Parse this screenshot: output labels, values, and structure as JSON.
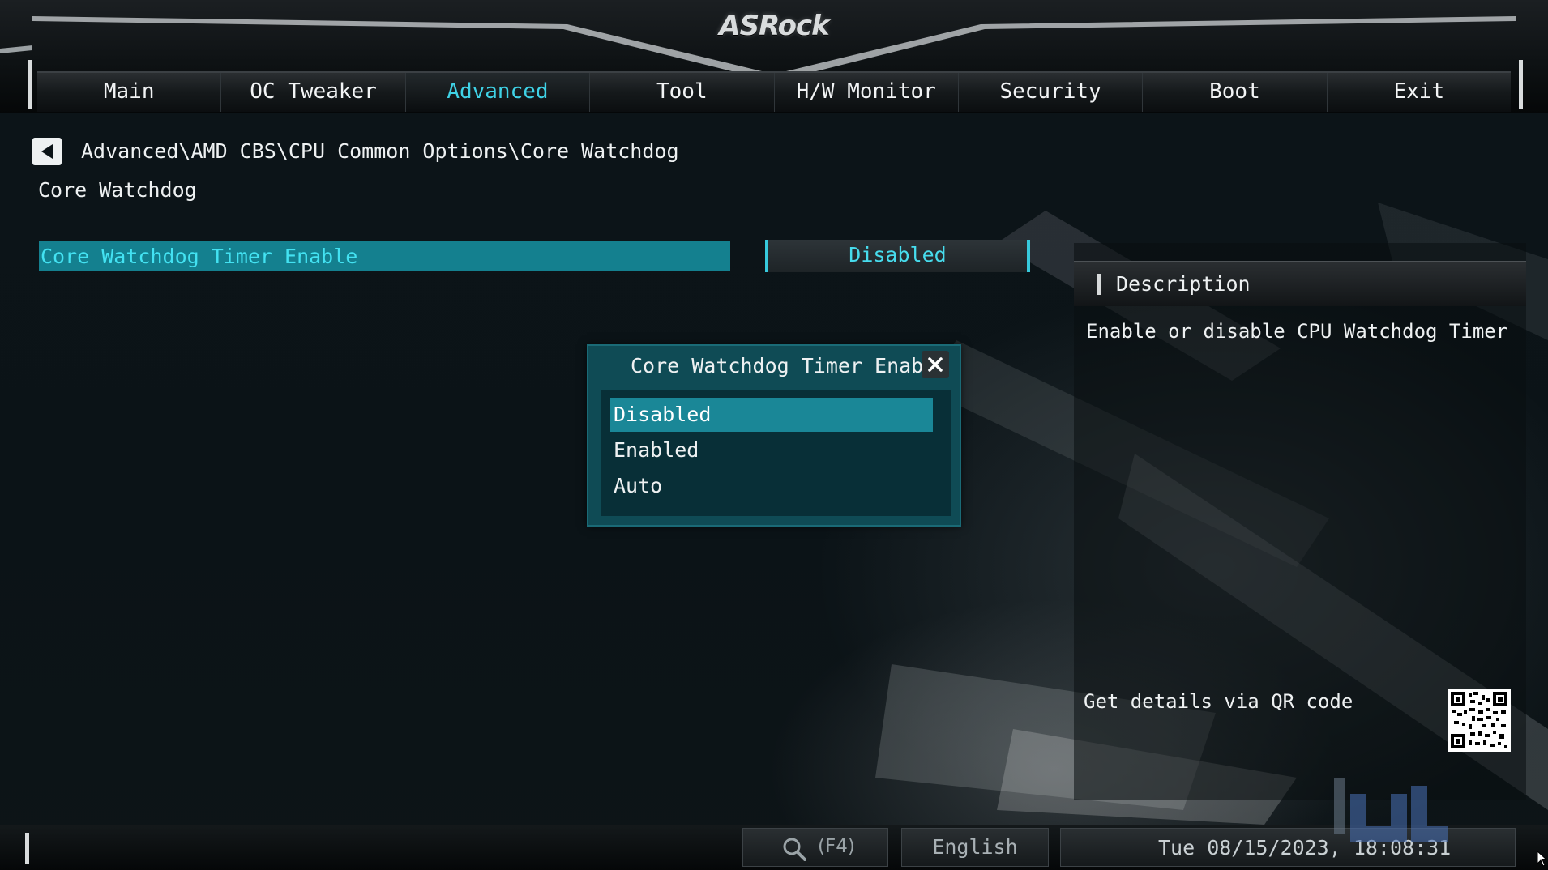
{
  "brand": {
    "logo_text": "ASRock"
  },
  "nav": {
    "tabs": [
      {
        "label": "Main"
      },
      {
        "label": "OC Tweaker"
      },
      {
        "label": "Advanced"
      },
      {
        "label": "Tool"
      },
      {
        "label": "H/W Monitor"
      },
      {
        "label": "Security"
      },
      {
        "label": "Boot"
      },
      {
        "label": "Exit"
      }
    ],
    "active_tab": "Advanced"
  },
  "breadcrumb": {
    "path": "Advanced\\AMD CBS\\CPU Common Options\\Core Watchdog"
  },
  "page": {
    "title": "Core Watchdog"
  },
  "setting": {
    "label": "Core Watchdog Timer Enable",
    "value": "Disabled"
  },
  "description": {
    "header": "Description",
    "text": "Enable or disable CPU Watchdog Timer",
    "qr_label": "Get details via QR code"
  },
  "popup": {
    "title": "Core Watchdog Timer Enable",
    "options": [
      {
        "label": "Disabled",
        "selected": true
      },
      {
        "label": "Enabled",
        "selected": false
      },
      {
        "label": "Auto",
        "selected": false
      }
    ]
  },
  "footer": {
    "search_key": "(F4)",
    "language": "English",
    "datetime": "Tue 08/15/2023, 18:08:31"
  },
  "icons": {
    "back": "back-arrow-icon",
    "close": "close-icon",
    "search": "search-icon",
    "qr": "qr-code-icon"
  },
  "colors": {
    "accent": "#3fd2e6",
    "selection": "#14808f",
    "popup_bg": "#0f4b55"
  }
}
